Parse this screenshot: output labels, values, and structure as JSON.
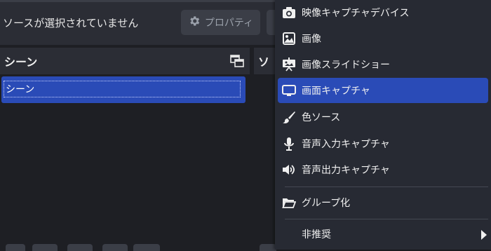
{
  "toolbar": {
    "no_source_text": "ソースが選択されていません",
    "properties_label": "プロパティ"
  },
  "scenes_dock": {
    "title": "シーン",
    "items": [
      {
        "label": "シーン",
        "selected": true
      }
    ]
  },
  "sources_dock": {
    "title_partial": "ソ"
  },
  "context_menu": {
    "items": [
      {
        "label": "映像キャプチャデバイス",
        "icon": "camera-icon"
      },
      {
        "label": "画像",
        "icon": "image-icon"
      },
      {
        "label": "画像スライドショー",
        "icon": "slideshow-icon"
      },
      {
        "label": "画面キャプチャ",
        "icon": "monitor-icon",
        "highlighted": true
      },
      {
        "label": "色ソース",
        "icon": "brush-icon"
      },
      {
        "label": "音声入力キャプチャ",
        "icon": "microphone-icon"
      },
      {
        "label": "音声出力キャプチャ",
        "icon": "speaker-icon"
      },
      {
        "label": "グループ化",
        "icon": "folder-icon"
      },
      {
        "label": "非推奨",
        "icon": "",
        "submenu": true
      }
    ]
  },
  "colors": {
    "accent": "#2a4bb7",
    "menu_bg": "#272a33",
    "panel_bg": "#1e1f24",
    "header_bg": "#2b2d35"
  }
}
